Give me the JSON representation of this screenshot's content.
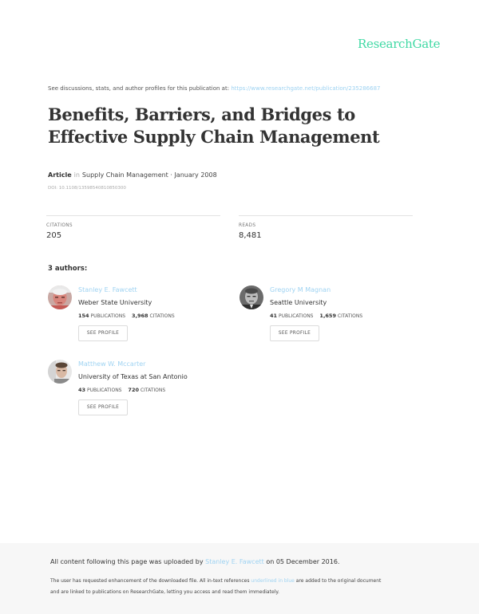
{
  "brand": "ResearchGate",
  "discussions": {
    "text": "See discussions, stats, and author profiles for this publication at:",
    "url": "https://www.researchgate.net/publication/235286687"
  },
  "publication": {
    "title": "Benefits, Barriers, and Bridges to Effective Supply Chain Management",
    "type": "Article",
    "in_word": "in",
    "venue_date": "Supply Chain Management · January 2008",
    "doi": "DOI: 10.1108/13598540810850300"
  },
  "stats": {
    "citations_label": "CITATIONS",
    "citations_value": "205",
    "reads_label": "READS",
    "reads_value": "8,481"
  },
  "authors_heading": "3 authors:",
  "authors": [
    {
      "name": "Stanley E. Fawcett",
      "institution": "Weber State University",
      "publications": "154",
      "publications_label": "PUBLICATIONS",
      "citations": "3,968",
      "citations_label": "CITATIONS",
      "button": "SEE PROFILE"
    },
    {
      "name": "Gregory M Magnan",
      "institution": "Seattle University",
      "publications": "41",
      "publications_label": "PUBLICATIONS",
      "citations": "1,659",
      "citations_label": "CITATIONS",
      "button": "SEE PROFILE"
    },
    {
      "name": "Matthew W. Mccarter",
      "institution": "University of Texas at San Antonio",
      "publications": "43",
      "publications_label": "PUBLICATIONS",
      "citations": "720",
      "citations_label": "CITATIONS",
      "button": "SEE PROFILE"
    }
  ],
  "footer": {
    "uploaded_prefix": "All content following this page was uploaded by",
    "uploaded_by": "Stanley E. Fawcett",
    "uploaded_suffix": "on 05 December 2016.",
    "note_prefix": "The user has requested enhancement of the downloaded file. All in-text references",
    "note_link": "underlined in blue",
    "note_suffix": "are added to the original document",
    "note_line2": "and are linked to publications on ResearchGate, letting you access and read them immediately."
  },
  "colors": {
    "brand": "#40d9a4",
    "link": "#9fd3f2",
    "footer_bg": "#f7f7f7"
  }
}
